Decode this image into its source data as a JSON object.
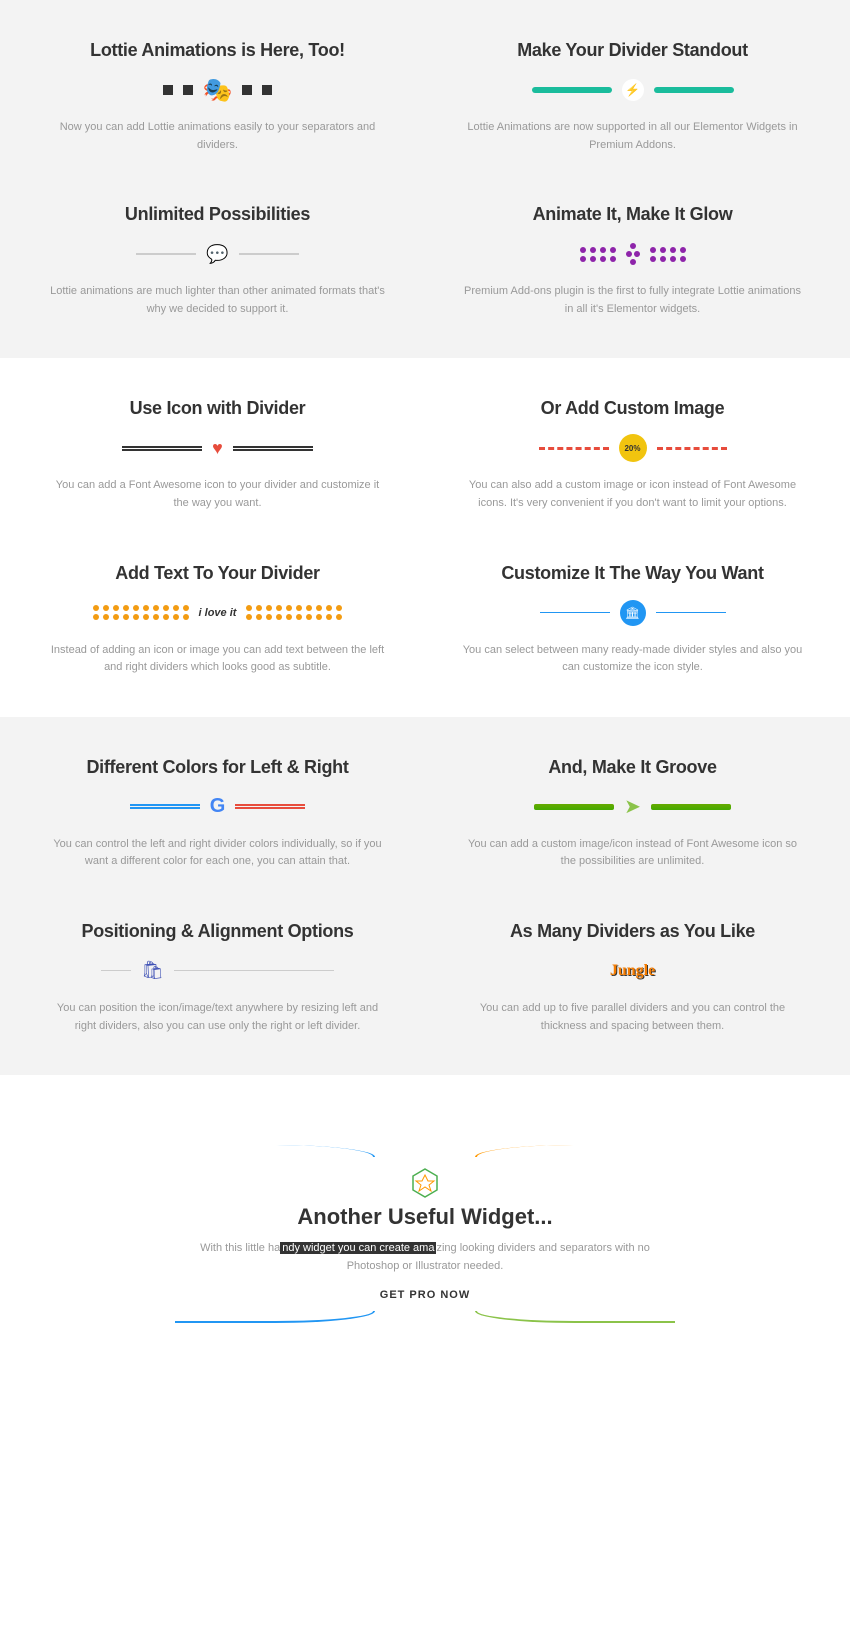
{
  "s1": {
    "c1": {
      "h": "Lottie Animations is Here, Too!",
      "p": "Now you can add Lottie animations easily to your separators and dividers."
    },
    "c2": {
      "h": "Make Your Divider Standout",
      "p": "Lottie Animations are now supported in all our Elementor Widgets in Premium Addons."
    },
    "c3": {
      "h": "Unlimited Possibilities",
      "p": "Lottie animations are much lighter than other animated formats that's why we decided to support it."
    },
    "c4": {
      "h": "Animate It, Make It Glow",
      "p": "Premium Add-ons plugin is the first to fully integrate Lottie animations in all it's Elementor widgets."
    }
  },
  "s2": {
    "c1": {
      "h": "Use Icon with Divider",
      "p": "You can add a Font Awesome icon to your divider and customize it the way you want."
    },
    "c2": {
      "h": "Or Add Custom Image",
      "p": "You can also add a custom image or icon instead of Font Awesome icons. It's very convenient if you don't want to limit your options.",
      "badge": "20%"
    },
    "c3": {
      "h": "Add Text To Your Divider",
      "t": "i love it",
      "p": "Instead of adding an icon or image you can add text between the left and right dividers which looks good as subtitle."
    },
    "c4": {
      "h": "Customize It The Way You Want",
      "p": "You can select between many ready-made divider styles and also you can customize the icon style."
    }
  },
  "s3": {
    "c1": {
      "h": "Different Colors for Left & Right",
      "p": "You can control the left and right divider colors individually, so if you want a different color for each one, you can attain that."
    },
    "c2": {
      "h": "And, Make It Groove",
      "p": "You can add a custom image/icon instead of Font Awesome icon so the possibilities are unlimited."
    },
    "c3": {
      "h": "Positioning & Alignment Options",
      "p": "You can position the icon/image/text anywhere by resizing left and right dividers, also you can use only the right or left divider."
    },
    "c4": {
      "h": "As Many Dividers as You Like",
      "t": "Jungle",
      "p": "You can add up to five parallel dividers and you can control the thickness and spacing between them."
    }
  },
  "footer": {
    "h": "Another Useful Widget...",
    "p1": "With this little ha",
    "hl": "ndy widget you can create ama",
    "p2": "zing looking dividers and separators with no Photoshop or Illustrator needed.",
    "btn": "GET PRO NOW"
  }
}
